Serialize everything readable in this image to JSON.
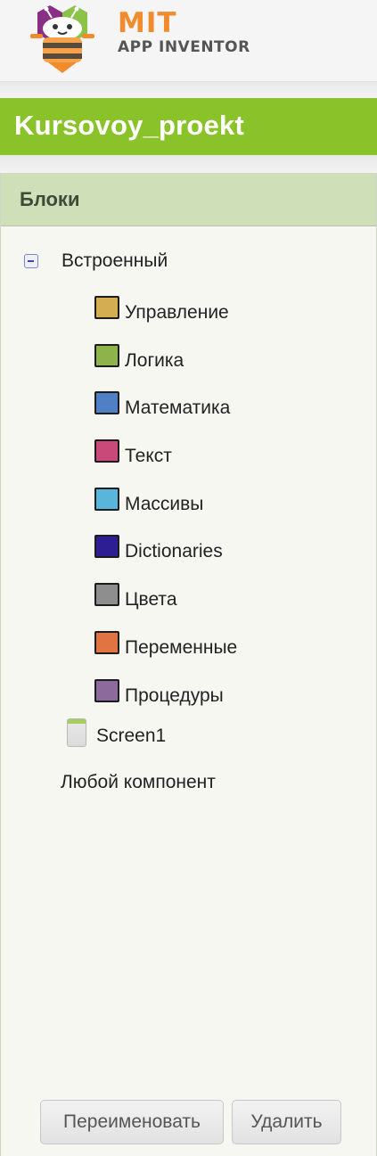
{
  "header": {
    "brand_top": "MIT",
    "brand_bottom": "APP INVENTOR"
  },
  "project": {
    "name": "Kursovoy_proekt"
  },
  "blocks_panel": {
    "title": "Блоки",
    "root_label": "Встроенный",
    "categories": [
      {
        "label": "Управление",
        "color": "#d4ad50",
        "icon": "control-swatch-icon"
      },
      {
        "label": "Логика",
        "color": "#8db44a",
        "icon": "logic-swatch-icon"
      },
      {
        "label": "Математика",
        "color": "#4f7fc4",
        "icon": "math-swatch-icon"
      },
      {
        "label": "Текст",
        "color": "#c94a79",
        "icon": "text-swatch-icon"
      },
      {
        "label": "Массивы",
        "color": "#5ab5dc",
        "icon": "lists-swatch-icon"
      },
      {
        "label": "Dictionaries",
        "color": "#2d1f93",
        "icon": "dictionaries-swatch-icon"
      },
      {
        "label": "Цвета",
        "color": "#8e8e8e",
        "icon": "colors-swatch-icon"
      },
      {
        "label": "Переменные",
        "color": "#e07443",
        "icon": "variables-swatch-icon"
      },
      {
        "label": "Процедуры",
        "color": "#8d6a9c",
        "icon": "procedures-swatch-icon"
      }
    ],
    "screen_label": "Screen1",
    "any_component_label": "Любой компонент"
  },
  "buttons": {
    "rename": "Переименовать",
    "delete": "Удалить"
  },
  "colors": {
    "accent_green": "#8ac22a",
    "panel_header_bg": "#cfe0b8",
    "brand_orange": "#f28b2c"
  }
}
